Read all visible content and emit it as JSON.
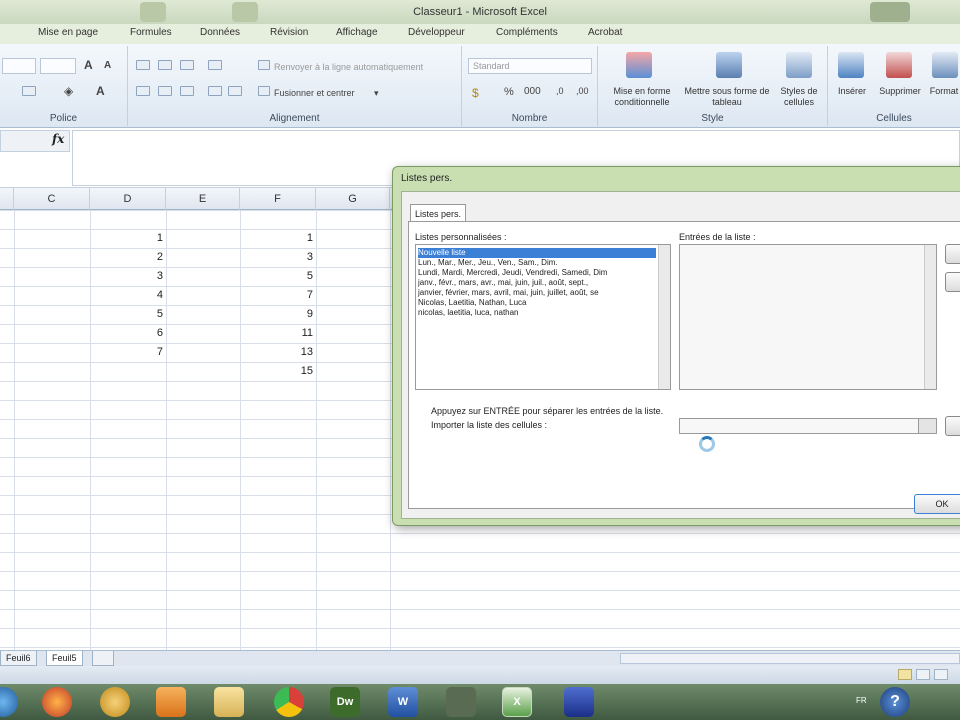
{
  "window": {
    "title": "Classeur1 - Microsoft Excel"
  },
  "ribbon_tabs": [
    "Mise en page",
    "Formules",
    "Données",
    "Révision",
    "Affichage",
    "Développeur",
    "Compléments",
    "Acrobat"
  ],
  "ribbon": {
    "font_group_label": "Police",
    "align_group_label": "Alignement",
    "wrap_text": "Renvoyer à la ligne automatiquement",
    "merge_center": "Fusionner et centrer",
    "number_group_label": "Nombre",
    "number_format": "Standard",
    "style_group_label": "Style",
    "conditional_format": "Mise en forme conditionnelle",
    "format_table": "Mettre sous forme de tableau",
    "cell_styles": "Styles de cellules",
    "cells_group_label": "Cellules",
    "insert": "Insérer",
    "delete": "Supprimer",
    "format": "Format"
  },
  "formula_bar": {
    "fx": "fx"
  },
  "columns": [
    "C",
    "D",
    "E",
    "F",
    "G"
  ],
  "column_D_values": [
    "1",
    "2",
    "3",
    "4",
    "5",
    "6",
    "7"
  ],
  "column_F_values": [
    "1",
    "3",
    "5",
    "7",
    "9",
    "11",
    "13",
    "15"
  ],
  "sheets": [
    "Feuil6",
    "Feuil5"
  ],
  "dialog": {
    "title": "Listes pers.",
    "tab": "Listes pers.",
    "lists_label": "Listes personnalisées :",
    "entries_label": "Entrées de la liste :",
    "lists": [
      "Nouvelle liste",
      "Lun., Mar., Mer., Jeu., Ven., Sam., Dim.",
      "Lundi, Mardi, Mercredi, Jeudi, Vendredi, Samedi, Dim",
      "janv., févr., mars, avr., mai, juin, juil., août, sept., ",
      "janvier, février, mars, avril, mai, juin, juillet, août, se",
      "Nicolas, Laetitia, Nathan, Luca",
      "nicolas, laetitia, luca, nathan"
    ],
    "hint": "Appuyez sur ENTRÉE pour séparer les entrées de la liste.",
    "import_label": "Importer la liste des cellules :",
    "ok": "OK"
  },
  "taskbar": {
    "language": "FR",
    "help": "?",
    "dw": "Dw"
  }
}
